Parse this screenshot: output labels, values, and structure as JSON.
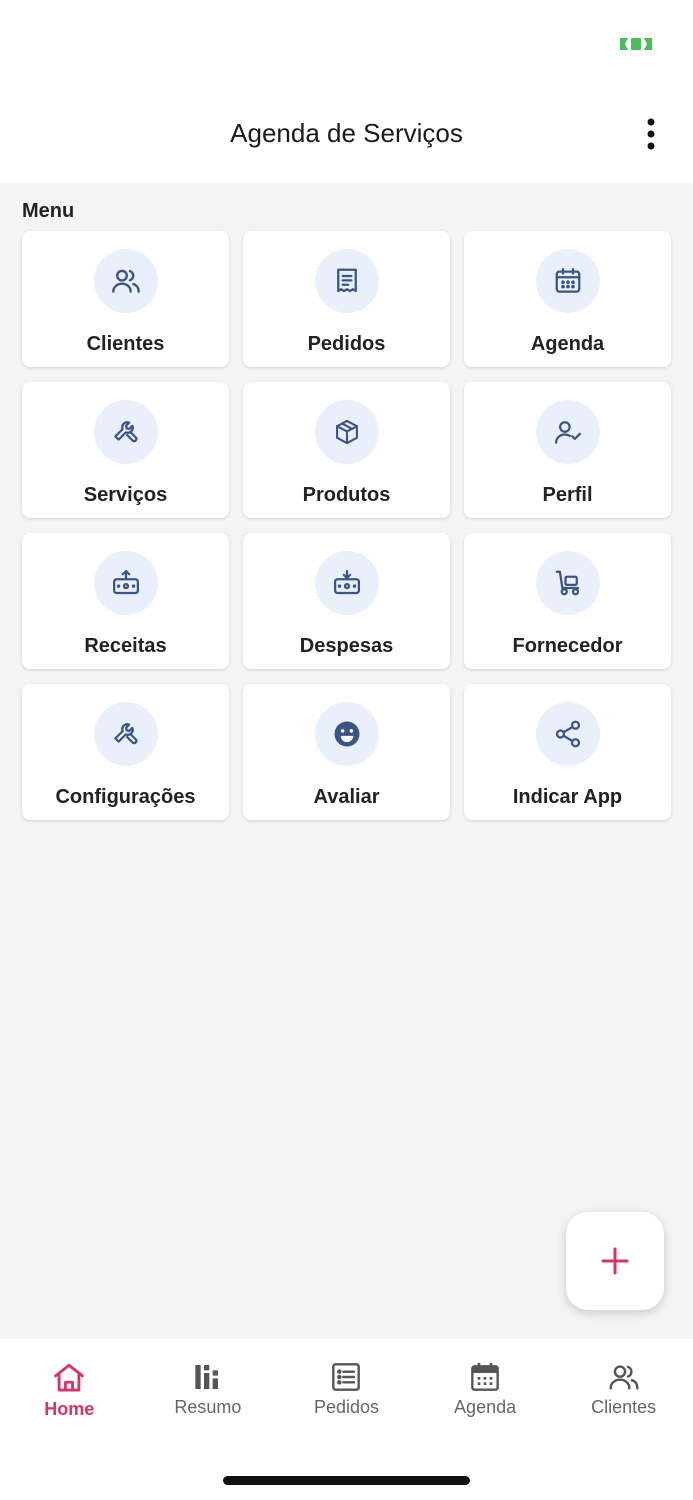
{
  "header": {
    "title": "Agenda de Serviços"
  },
  "menu": {
    "label": "Menu",
    "items": [
      {
        "label": "Clientes",
        "icon": "users-icon"
      },
      {
        "label": "Pedidos",
        "icon": "receipt-icon"
      },
      {
        "label": "Agenda",
        "icon": "calendar-icon"
      },
      {
        "label": "Serviços",
        "icon": "tools-icon"
      },
      {
        "label": "Produtos",
        "icon": "box-icon"
      },
      {
        "label": "Perfil",
        "icon": "user-check-icon"
      },
      {
        "label": "Receitas",
        "icon": "cash-in-icon"
      },
      {
        "label": "Despesas",
        "icon": "cash-out-icon"
      },
      {
        "label": "Fornecedor",
        "icon": "hand-truck-icon"
      },
      {
        "label": "Configurações",
        "icon": "settings-tools-icon"
      },
      {
        "label": "Avaliar",
        "icon": "smile-icon"
      },
      {
        "label": "Indicar App",
        "icon": "share-icon"
      }
    ]
  },
  "bottom_nav": {
    "items": [
      {
        "label": "Home",
        "icon": "home-icon",
        "active": true
      },
      {
        "label": "Resumo",
        "icon": "chart-icon",
        "active": false
      },
      {
        "label": "Pedidos",
        "icon": "list-icon",
        "active": false
      },
      {
        "label": "Agenda",
        "icon": "calendar-icon",
        "active": false
      },
      {
        "label": "Clientes",
        "icon": "users-icon",
        "active": false
      }
    ]
  },
  "colors": {
    "accent": "#d6336c",
    "icon_primary": "#3b5488",
    "icon_bg": "#e9f0fb",
    "battery": "#4cbb5a"
  }
}
